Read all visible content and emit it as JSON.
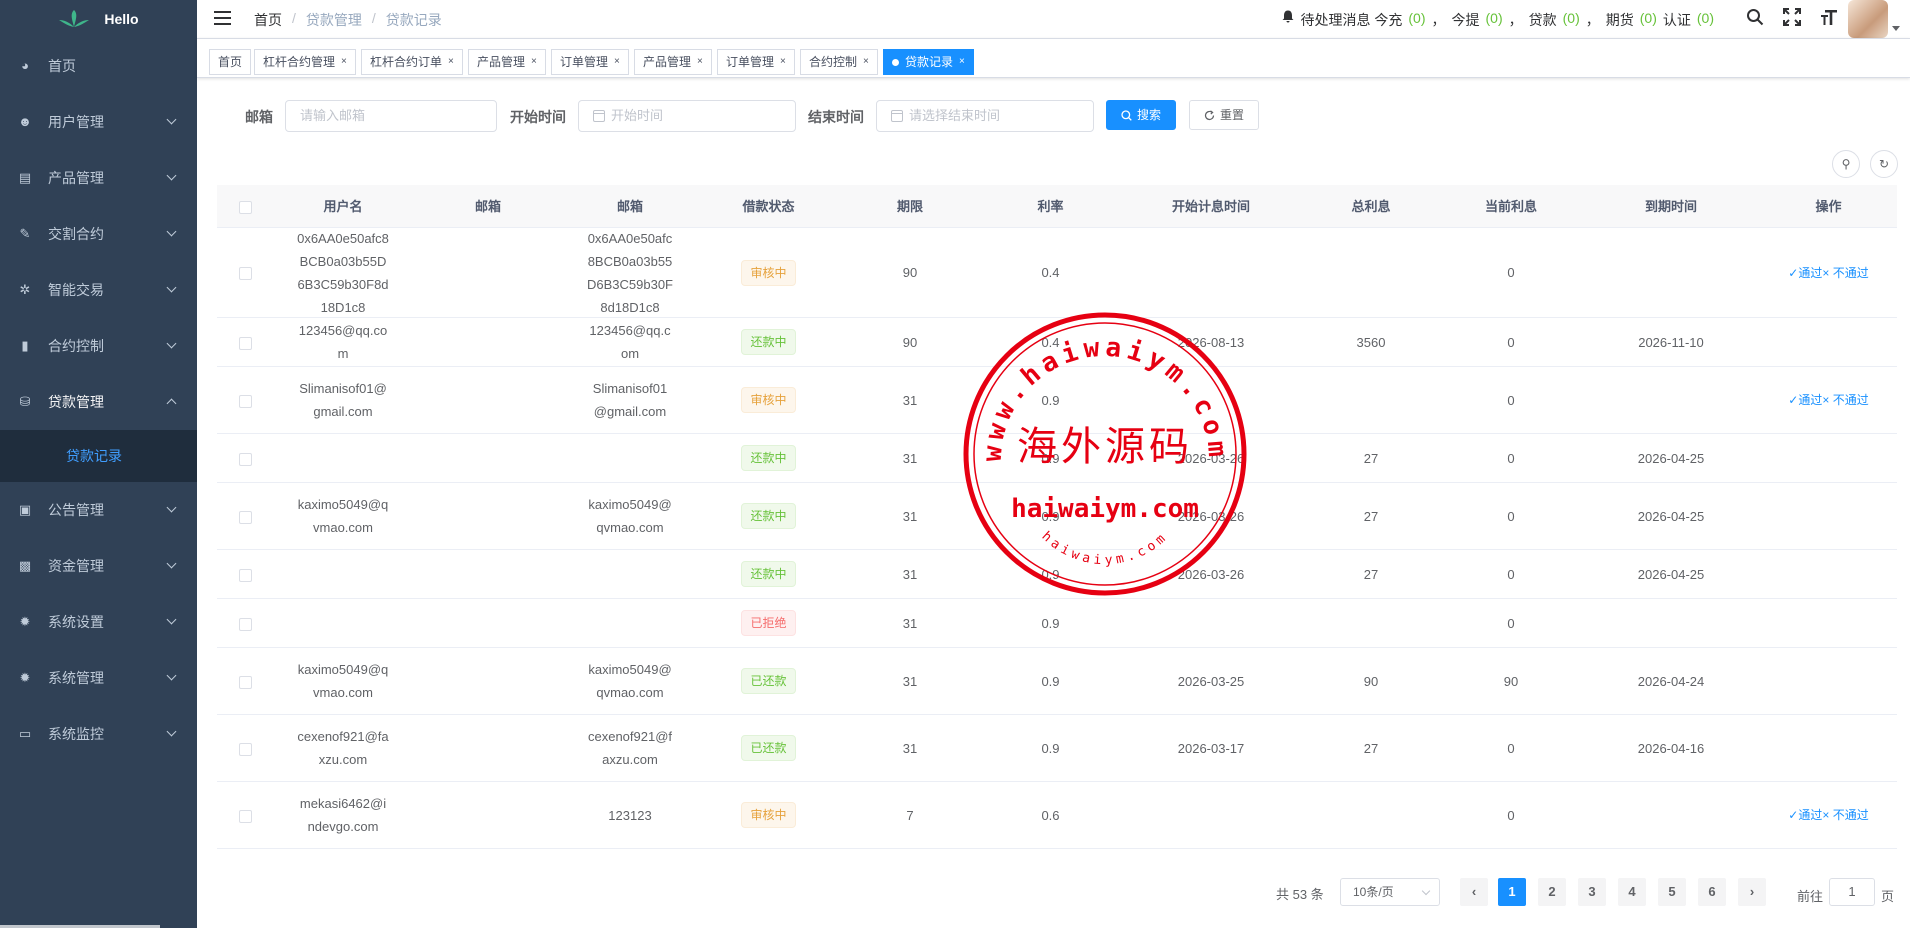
{
  "app": {
    "logo_text": "Hello"
  },
  "sidebar": {
    "items": [
      {
        "label": "首页",
        "icon": "dashboard-icon",
        "has_arrow": false
      },
      {
        "label": "用户管理",
        "icon": "user-icon",
        "has_arrow": true
      },
      {
        "label": "产品管理",
        "icon": "documentation-icon",
        "has_arrow": true
      },
      {
        "label": "交割合约",
        "icon": "edit-icon",
        "has_arrow": true
      },
      {
        "label": "智能交易",
        "icon": "gear-icon",
        "has_arrow": true
      },
      {
        "label": "合约控制",
        "icon": "chart-icon",
        "has_arrow": true
      },
      {
        "label": "贷款管理",
        "icon": "money-icon",
        "has_arrow": true,
        "open": true
      },
      {
        "label": "公告管理",
        "icon": "message-icon",
        "has_arrow": true
      },
      {
        "label": "资金管理",
        "icon": "wallet-icon",
        "has_arrow": true
      },
      {
        "label": "系统设置",
        "icon": "settings-icon",
        "has_arrow": true
      },
      {
        "label": "系统管理",
        "icon": "system-icon",
        "has_arrow": true
      },
      {
        "label": "系统监控",
        "icon": "monitor-icon",
        "has_arrow": true
      }
    ],
    "sub_item": "贷款记录"
  },
  "breadcrumb": [
    "首页",
    "贷款管理",
    "贷款记录"
  ],
  "notice": {
    "prefix": "待处理消息 今充",
    "recharge": "(0)",
    "withdraw_label": "今提",
    "withdraw": "(0)",
    "loan_label": "贷款",
    "loan": "(0)",
    "futures_label": "期货",
    "futures": "(0)",
    "auth_label": "认证",
    "auth": "(0)",
    "comma": "，"
  },
  "tags": [
    {
      "label": "首页",
      "closable": false
    },
    {
      "label": "杠杆合约管理",
      "closable": true
    },
    {
      "label": "杠杆合约订单",
      "closable": true
    },
    {
      "label": "产品管理",
      "closable": true
    },
    {
      "label": "订单管理",
      "closable": true
    },
    {
      "label": "产品管理",
      "closable": true
    },
    {
      "label": "订单管理",
      "closable": true
    },
    {
      "label": "合约控制",
      "closable": true
    },
    {
      "label": "贷款记录",
      "closable": true,
      "active": true
    }
  ],
  "search": {
    "email_label": "邮箱",
    "email_placeholder": "请输入邮箱",
    "start_label": "开始时间",
    "start_placeholder": "开始时间",
    "end_label": "结束时间",
    "end_placeholder": "请选择结束时间",
    "search_btn": "搜索",
    "reset_btn": "重置"
  },
  "table": {
    "headers": [
      "",
      "用户名",
      "邮箱",
      "邮箱",
      "借款状态",
      "期限",
      "利率",
      "开始计息时间",
      "总利息",
      "当前利息",
      "到期时间",
      "操作"
    ],
    "rows": [
      {
        "username": "0x6AA0e50afc8BCB0a03b55D6B3C59b30F8d18D1c8",
        "email1": "",
        "email2": "0x6AA0e50afc8BCB0a03b55D6B3C59b30F8d18D1c8",
        "status": "审核中",
        "status_type": "warn",
        "term": "90",
        "rate": "0.4",
        "start": "",
        "total": "",
        "current": "0",
        "due": "",
        "ops": true,
        "h": 90
      },
      {
        "username": "123456@qq.com",
        "email1": "",
        "email2": "123456@qq.com",
        "status": "还款中",
        "status_type": "succ",
        "term": "90",
        "rate": "0.4",
        "start": "2026-08-13",
        "total": "3560",
        "current": "0",
        "due": "2026-11-10",
        "ops": false,
        "h": 49
      },
      {
        "username": "Slimanisof01@gmail.com",
        "email1": "",
        "email2": "Slimanisof01@gmail.com",
        "status": "审核中",
        "status_type": "warn",
        "term": "31",
        "rate": "0.9",
        "start": "",
        "total": "",
        "current": "0",
        "due": "",
        "ops": true,
        "h": 67
      },
      {
        "username": "",
        "email1": "",
        "email2": "",
        "status": "还款中",
        "status_type": "succ",
        "term": "31",
        "rate": "0.9",
        "start": "2026-03-26",
        "total": "27",
        "current": "0",
        "due": "2026-04-25",
        "ops": false,
        "h": 49
      },
      {
        "username": "kaximo5049@qvmao.com",
        "email1": "",
        "email2": "kaximo5049@qvmao.com",
        "status": "还款中",
        "status_type": "succ",
        "term": "31",
        "rate": "0.9",
        "start": "2026-03-26",
        "total": "27",
        "current": "0",
        "due": "2026-04-25",
        "ops": false,
        "h": 67
      },
      {
        "username": "",
        "email1": "",
        "email2": "",
        "status": "还款中",
        "status_type": "succ",
        "term": "31",
        "rate": "0.9",
        "start": "2026-03-26",
        "total": "27",
        "current": "0",
        "due": "2026-04-25",
        "ops": false,
        "h": 49
      },
      {
        "username": "",
        "email1": "",
        "email2": "",
        "status": "已拒绝",
        "status_type": "dang",
        "term": "31",
        "rate": "0.9",
        "start": "",
        "total": "",
        "current": "0",
        "due": "",
        "ops": false,
        "h": 49
      },
      {
        "username": "kaximo5049@qvmao.com",
        "email1": "",
        "email2": "kaximo5049@qvmao.com",
        "status": "已还款",
        "status_type": "succ",
        "term": "31",
        "rate": "0.9",
        "start": "2026-03-25",
        "total": "90",
        "current": "90",
        "due": "2026-04-24",
        "ops": false,
        "h": 67
      },
      {
        "username": "cexenof921@faxzu.com",
        "email1": "",
        "email2": "cexenof921@faxzu.com",
        "status": "已还款",
        "status_type": "succ",
        "term": "31",
        "rate": "0.9",
        "start": "2026-03-17",
        "total": "27",
        "current": "0",
        "due": "2026-04-16",
        "ops": false,
        "h": 67
      },
      {
        "username": "mekasi6462@indevgo.com",
        "email1": "",
        "email2": "123123",
        "status": "审核中",
        "status_type": "warn",
        "term": "7",
        "rate": "0.6",
        "start": "",
        "total": "",
        "current": "0",
        "due": "",
        "ops": true,
        "h": 67
      }
    ],
    "approve": "✓通过",
    "reject": "× 不通过"
  },
  "pagination": {
    "total": "共 53 条",
    "page_size": "10条/页",
    "pages": [
      "1",
      "2",
      "3",
      "4",
      "5",
      "6"
    ],
    "current": "1",
    "goto_label": "前往",
    "goto_value": "1",
    "page_unit": "页"
  },
  "watermark": {
    "lines": [
      "www.haiwaiym.com",
      "海外源码",
      "haiwaiym.com",
      "haiwaiym.com"
    ]
  },
  "colors": {
    "sidebar": "#304156",
    "primary": "#1890ff",
    "success": "#67c23a",
    "warning": "#e6a23c",
    "danger": "#f56c6c",
    "stamp": "#e60012"
  }
}
